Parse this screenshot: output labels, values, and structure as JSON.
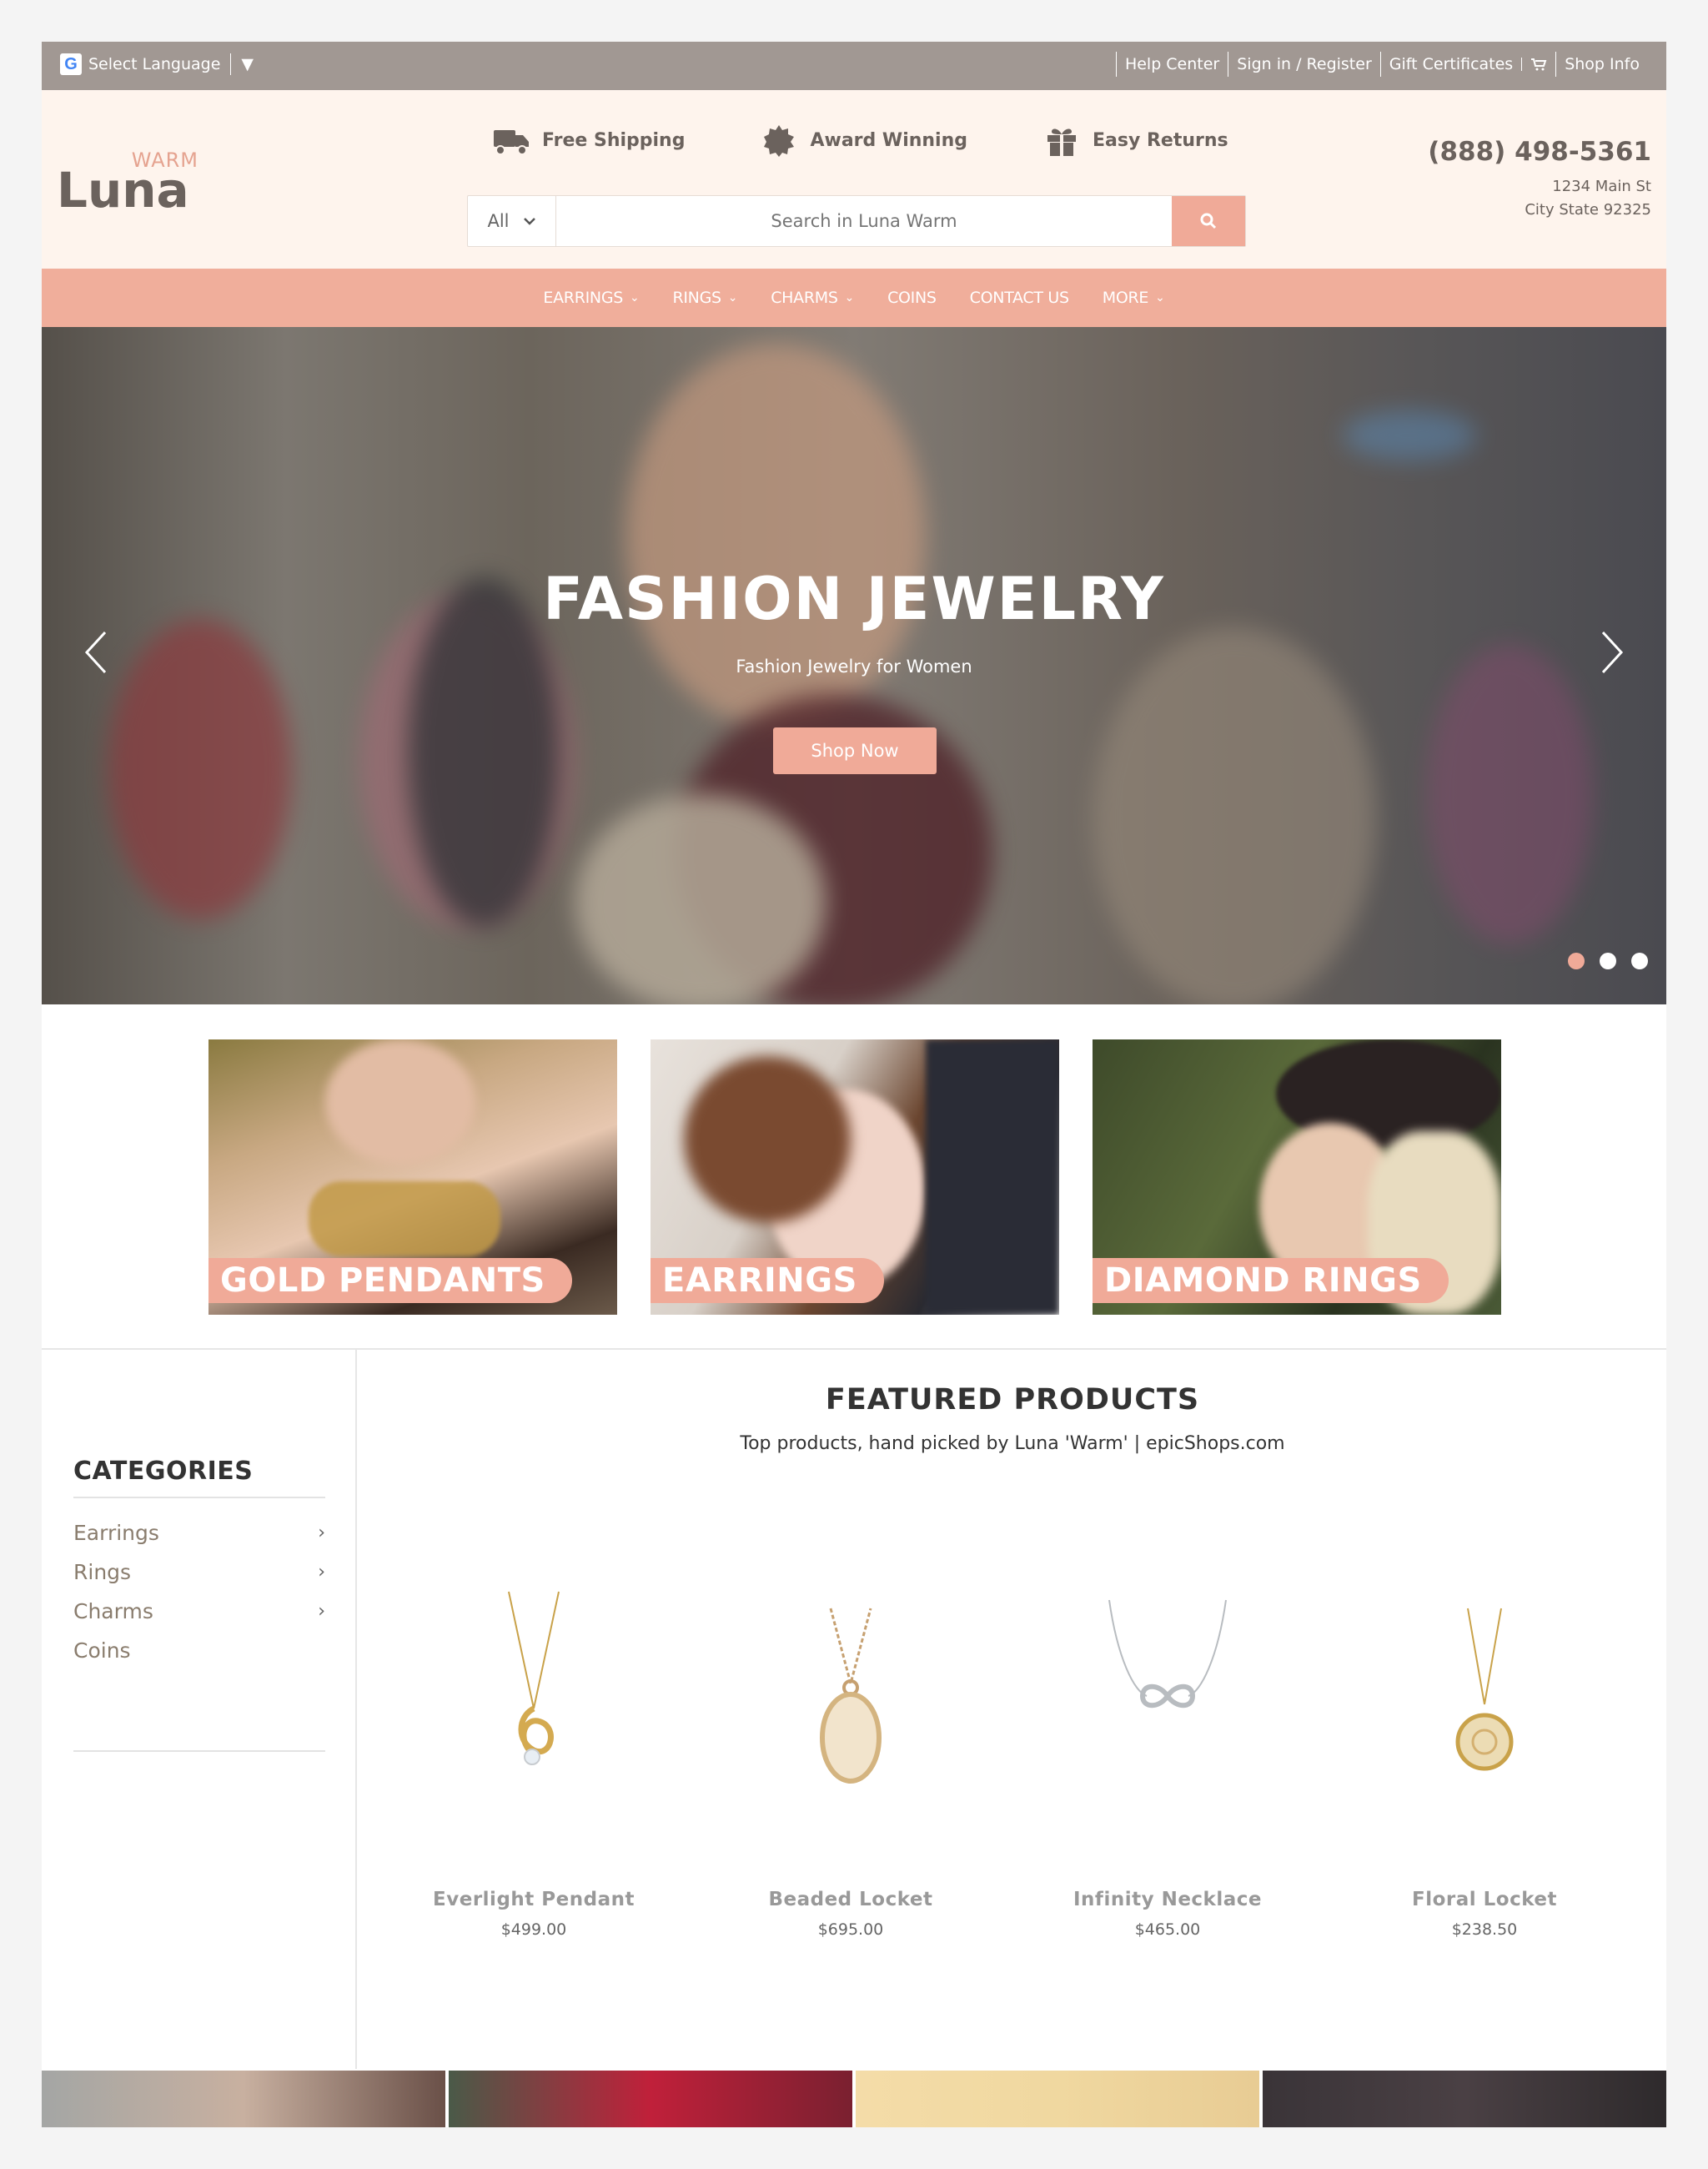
{
  "topbar": {
    "language_label": "Select Language",
    "language_caret": "▼",
    "links": [
      "Help Center",
      "Sign in / Register",
      "Gift Certificates",
      "Shop Info"
    ]
  },
  "header": {
    "logo_small": "WARM",
    "logo_main": "Luna",
    "features": [
      "Free Shipping",
      "Award Winning",
      "Easy Returns"
    ],
    "search": {
      "category": "All",
      "placeholder": "Search in Luna Warm"
    },
    "phone": "(888) 498-5361",
    "address_line1": "1234 Main St",
    "address_line2": "City State 92325"
  },
  "nav": {
    "items": [
      "EARRINGS",
      "RINGS",
      "CHARMS",
      "COINS",
      "CONTACT US",
      "MORE"
    ]
  },
  "hero": {
    "title": "FASHION JEWELRY",
    "subtitle": "Fashion Jewelry for Women",
    "button": "Shop Now"
  },
  "promos": [
    "GOLD PENDANTS",
    "EARRINGS",
    "DIAMOND RINGS"
  ],
  "sidebar": {
    "heading": "CATEGORIES",
    "items": [
      "Earrings",
      "Rings",
      "Charms",
      "Coins"
    ]
  },
  "featured": {
    "heading": "FEATURED PRODUCTS",
    "subtitle": "Top products, hand picked by Luna 'Warm' | epicShops.com",
    "products": [
      {
        "name": "Everlight Pendant",
        "price": "$499.00"
      },
      {
        "name": "Beaded Locket",
        "price": "$695.00"
      },
      {
        "name": "Infinity Necklace",
        "price": "$465.00"
      },
      {
        "name": "Floral Locket",
        "price": "$238.50"
      }
    ]
  },
  "colors": {
    "accent": "#f0aa98",
    "topbar": "#a19893",
    "header_bg": "#fef4ed",
    "text_brown": "#6b625d"
  }
}
